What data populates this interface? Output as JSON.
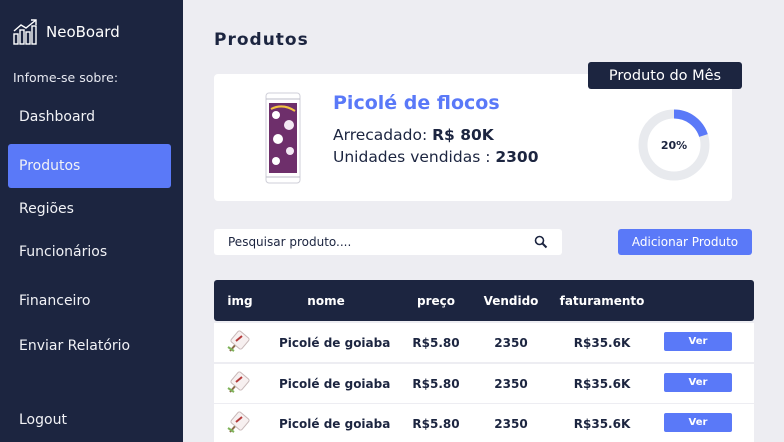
{
  "app": {
    "name": "NeoBoard"
  },
  "sidebar": {
    "info_label": "Infome-se sobre:",
    "items": [
      {
        "label": "Dashboard",
        "active": false
      },
      {
        "label": "Produtos",
        "active": true
      },
      {
        "label": "Regiões",
        "active": false
      },
      {
        "label": "Funcionários",
        "active": false
      },
      {
        "label": "Financeiro",
        "active": false
      },
      {
        "label": "Enviar Relatório",
        "active": false
      }
    ],
    "logout_label": "Logout"
  },
  "page": {
    "title": "Produtos"
  },
  "featured": {
    "badge": "Produto do Mês",
    "name": "Picolé de flocos",
    "revenue_label": "Arrecadado: ",
    "revenue_value": "R$ 80K",
    "units_label": "Unidades vendidas : ",
    "units_value": "2300",
    "percent_label": "20%",
    "percent_value": 0.2
  },
  "search": {
    "placeholder": "Pesquisar produto...."
  },
  "add_button": {
    "label": "Adicionar Produto"
  },
  "table": {
    "columns": [
      "img",
      "nome",
      "preço",
      "Vendido",
      "faturamento"
    ],
    "rows": [
      {
        "name": "Picolé de goiaba",
        "price": "R$5.80",
        "sold": "2350",
        "revenue": "R$35.6K",
        "action": "Ver"
      },
      {
        "name": "Picolé de goiaba",
        "price": "R$5.80",
        "sold": "2350",
        "revenue": "R$35.6K",
        "action": "Ver"
      },
      {
        "name": "Picolé de goiaba",
        "price": "R$5.80",
        "sold": "2350",
        "revenue": "R$35.6K",
        "action": "Ver"
      }
    ]
  },
  "colors": {
    "sidebar": "#1c2540",
    "accent": "#5a79f8",
    "background": "#ededf2",
    "track": "#e8eaee"
  },
  "icons": {
    "brand": "chart-growth-icon",
    "search": "magnifier-icon",
    "product": "popsicle-icon"
  }
}
